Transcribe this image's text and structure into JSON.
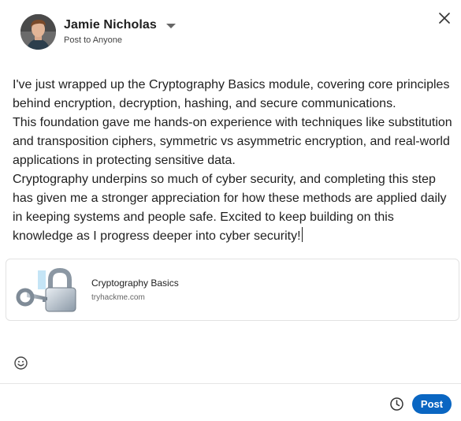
{
  "author": {
    "name": "Jamie Nicholas",
    "audience": "Post to Anyone",
    "avatar_icon": "user-avatar",
    "dropdown_icon": "caret-down-icon"
  },
  "close_icon": "close-icon",
  "editor": {
    "paragraphs": [
      "I've just wrapped up the Cryptography Basics module, covering core principles behind encryption, decryption, hashing, and secure communications.",
      "This foundation gave me hands-on experience with techniques like substitution and transposition ciphers, symmetric vs asymmetric encryption, and real-world applications in protecting sensitive data.",
      "Cryptography underpins so much of cyber security, and completing this step has given me a stronger appreciation for how these methods are applied daily in keeping systems and people safe. Excited to keep building on this knowledge as I progress deeper into cyber security!"
    ]
  },
  "link_preview": {
    "title": "Cryptography Basics",
    "domain": "tryhackme.com",
    "thumbnail_icon": "padlock-key-icon"
  },
  "toolbar": {
    "emoji_icon": "emoji-icon",
    "schedule_icon": "clock-icon",
    "post_label": "Post"
  },
  "colors": {
    "accent": "#0a66c2",
    "text": "#1f1f1f",
    "muted": "#666666",
    "border": "#e2e2e2"
  }
}
